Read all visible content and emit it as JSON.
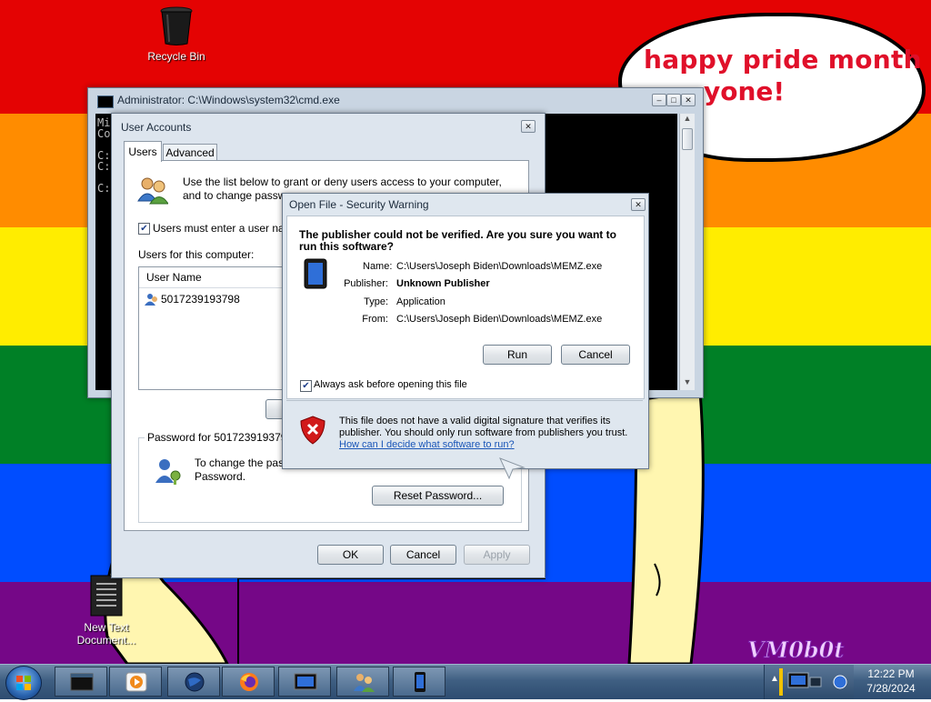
{
  "desktop": {
    "stripe_colors": [
      "#e40303",
      "#ff8c00",
      "#ffed00",
      "#008026",
      "#004dff",
      "#750787"
    ],
    "icons": [
      {
        "label": "Recycle Bin",
        "icon": "recycle-bin-icon"
      },
      {
        "label": "New Text Document...",
        "icon": "text-document-icon"
      }
    ],
    "bubble_text_line1": "happy pride month",
    "bubble_text_line2": "yone!",
    "corner_logo": "VM0b0t"
  },
  "cmd_window": {
    "title": "Administrator: C:\\Windows\\system32\\cmd.exe",
    "text_lines": [
      "Mi",
      "Co",
      "",
      "C:",
      "C:",
      "",
      "C:"
    ]
  },
  "user_accounts": {
    "title": "User Accounts",
    "tabs": [
      "Users",
      "Advanced"
    ],
    "intro_line1": "Use the list below to grant or deny users access to your computer,",
    "intro_line2": "and to change passw",
    "must_enter_label": "Users must enter a user nar",
    "users_for_label": "Users for this computer:",
    "list_header": "User Name",
    "users": [
      "5017239193798"
    ],
    "password_group_label": "Password for 5017239193798",
    "password_text_line1": "To change the pas",
    "password_text_line2": "Password.",
    "reset_password_button": "Reset Password...",
    "ok_button": "OK",
    "cancel_button": "Cancel",
    "apply_button": "Apply"
  },
  "security_warning": {
    "title": "Open File - Security Warning",
    "heading": "The publisher could not be verified.  Are you sure you want to run this software?",
    "fields": [
      {
        "label": "Name:",
        "value": "C:\\Users\\Joseph Biden\\Downloads\\MEMZ.exe",
        "bold": false
      },
      {
        "label": "Publisher:",
        "value": "Unknown Publisher",
        "bold": true
      },
      {
        "label": "Type:",
        "value": "Application",
        "bold": false
      },
      {
        "label": "From:",
        "value": "C:\\Users\\Joseph Biden\\Downloads\\MEMZ.exe",
        "bold": false
      }
    ],
    "run_button": "Run",
    "cancel_button": "Cancel",
    "always_ask_label": "Always ask before opening this file",
    "always_ask_checked": true,
    "footer_text_line1": "This file does not have a valid digital signature that verifies its",
    "footer_text_line2": "publisher.  You should only run software from publishers you trust.",
    "footer_link": "How can I decide what software to run?"
  },
  "taskbar": {
    "start_icon": "windows-start-icon",
    "buttons": [
      "cmd-window-icon",
      "media-player-icon",
      "globe-icon",
      "firefox-icon",
      "monitor-icon",
      "user-accounts-icon",
      "memz-phone-icon"
    ],
    "clock_time": "12:22 PM",
    "clock_date": "7/28/2024"
  }
}
